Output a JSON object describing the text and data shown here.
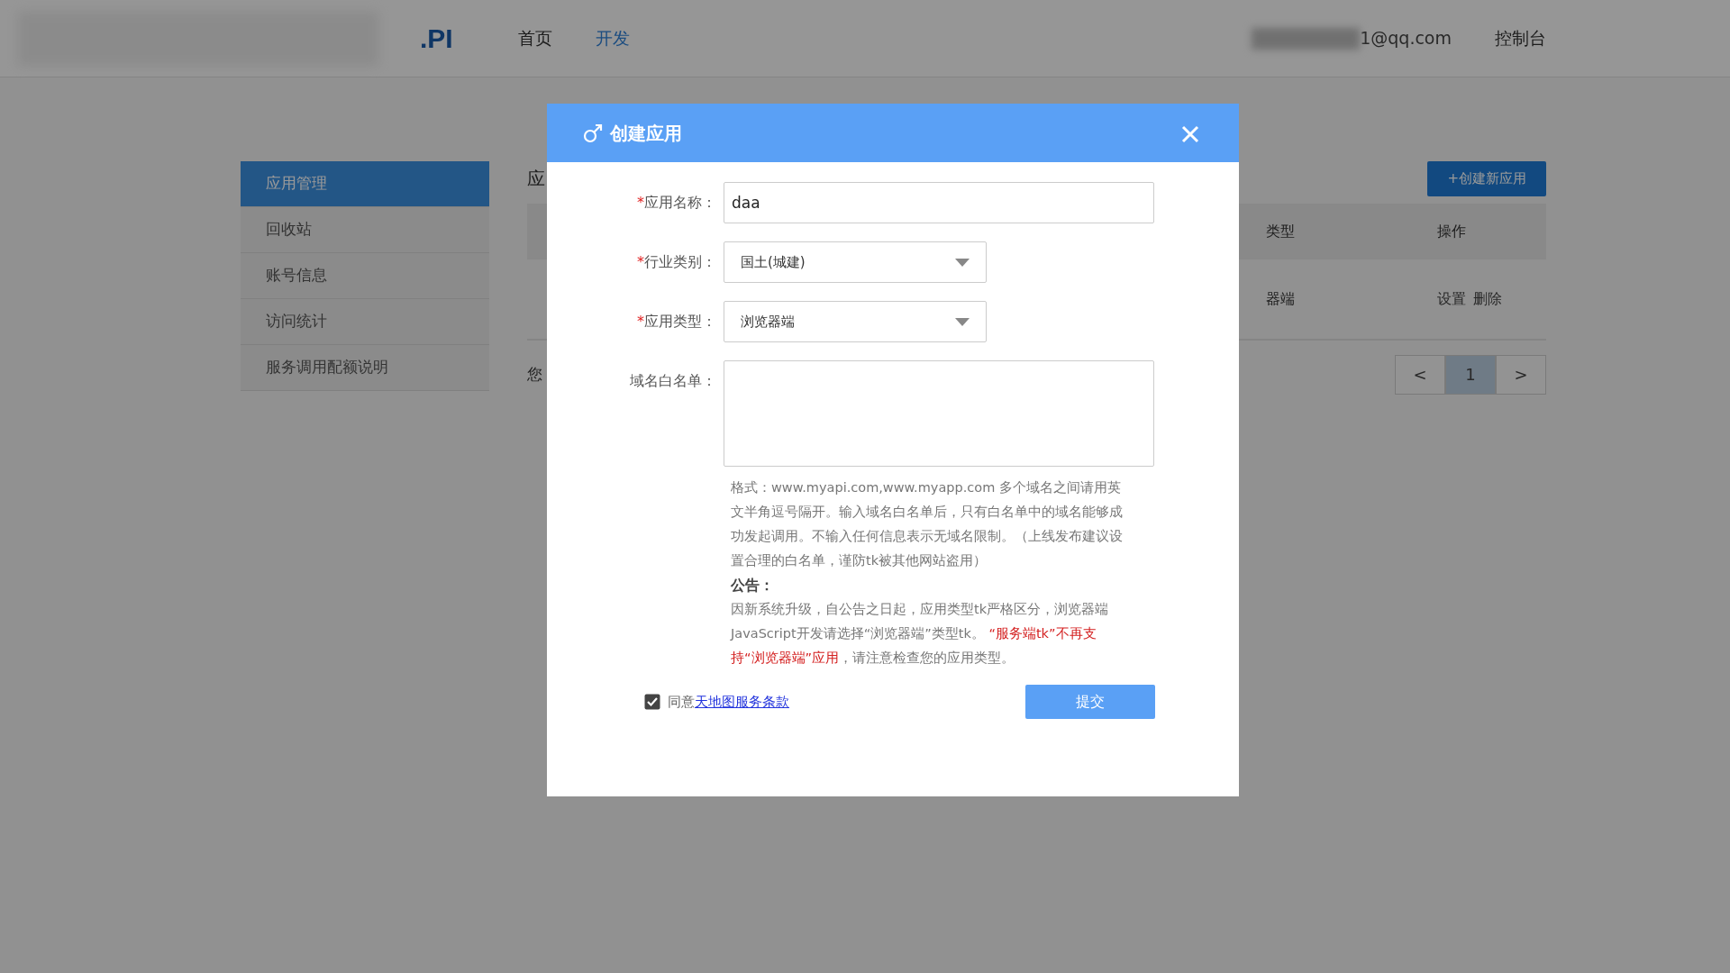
{
  "header": {
    "logo": ".PI",
    "nav": [
      {
        "label": "首页",
        "selected": false
      },
      {
        "label": "开发",
        "selected": true
      }
    ],
    "user_email": "1@qq.com",
    "console_link": "控制台"
  },
  "sidebar": {
    "items": [
      {
        "label": "应用管理",
        "selected": true
      },
      {
        "label": "回收站",
        "selected": false
      },
      {
        "label": "账号信息",
        "selected": false
      },
      {
        "label": "访问统计",
        "selected": false
      },
      {
        "label": "服务调用配额说明",
        "selected": false
      }
    ]
  },
  "content": {
    "title": "应",
    "create_button": "+创建新应用",
    "table": {
      "columns": [
        "类型",
        "操作"
      ],
      "rows": [
        {
          "column_1": "器端",
          "actions": [
            "设置",
            "删除"
          ]
        }
      ]
    },
    "pagination": {
      "prev": "<",
      "pages": [
        {
          "label": "1",
          "selected": true
        }
      ],
      "next": ">"
    },
    "note": "您"
  },
  "dialog": {
    "title": "创建应用",
    "fields": [
      {
        "kind": "input",
        "required_mark": "*",
        "label": "应用名称：",
        "value": "daa"
      },
      {
        "kind": "select",
        "required_mark": "*",
        "label": "行业类别：",
        "value": "国土(城建)"
      },
      {
        "kind": "select",
        "required_mark": "*",
        "label": "应用类型：",
        "value": "浏览器端"
      },
      {
        "kind": "textarea",
        "label": "域名白名单："
      }
    ],
    "help_text": "格式：www.myapi.com,www.myapp.com 多个域名之间请用英文半角逗号隔开。输入域名白名单后，只有白名单中的域名能够成功发起调用。不输入任何信息表示无域名限制。（上线发布建议设置合理的白名单，谨防tk被其他网站盗用）",
    "notice_title": "公告：",
    "notice": [
      {
        "text": "因新系统升级，自公告之日起，应用类型tk严格区分，浏览器端JavaScript开发请选择“浏览器端”类型tk。 ",
        "emphasis": false
      },
      {
        "text": "“服务端tk”不再支持“浏览器端”应用",
        "emphasis": true
      },
      {
        "text": "，请注意检查您的应用类型。",
        "emphasis": false
      }
    ],
    "agree": {
      "checked": true,
      "text": "同意",
      "link": "天地图服务条款"
    },
    "submit": "提交"
  }
}
